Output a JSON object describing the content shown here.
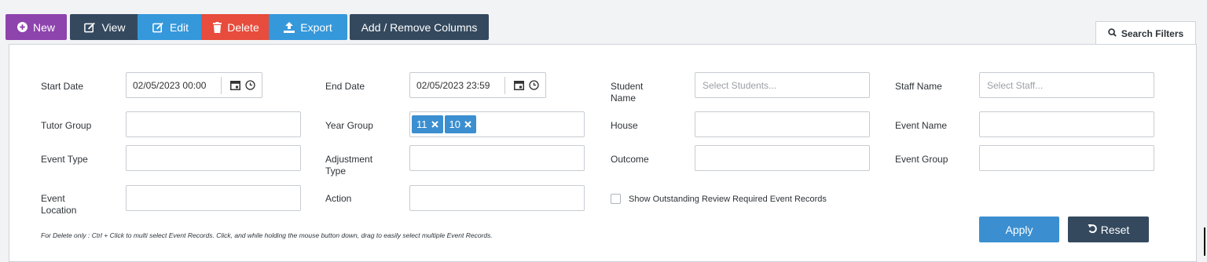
{
  "toolbar": {
    "new_label": "New",
    "view_label": "View",
    "edit_label": "Edit",
    "delete_label": "Delete",
    "export_label": "Export",
    "columns_label": "Add / Remove Columns"
  },
  "search_tab": {
    "label": "Search Filters"
  },
  "filters": {
    "start_date": {
      "label": "Start Date",
      "value": "02/05/2023 00:00"
    },
    "end_date": {
      "label": "End Date",
      "value": "02/05/2023 23:59"
    },
    "student_name": {
      "label_line1": "Student",
      "label_line2": "Name",
      "placeholder": "Select Students..."
    },
    "staff_name": {
      "label": "Staff Name",
      "placeholder": "Select Staff..."
    },
    "tutor_group": {
      "label": "Tutor Group"
    },
    "year_group": {
      "label": "Year Group",
      "tags": [
        "11",
        "10"
      ]
    },
    "house": {
      "label": "House"
    },
    "event_name": {
      "label": "Event Name"
    },
    "event_type": {
      "label": "Event Type"
    },
    "adjustment_type": {
      "label_line1": "Adjustment",
      "label_line2": "Type"
    },
    "outcome": {
      "label": "Outcome"
    },
    "event_group": {
      "label": "Event Group"
    },
    "event_location": {
      "label_line1": "Event",
      "label_line2": "Location"
    },
    "action": {
      "label": "Action"
    },
    "outstanding_review": {
      "label": "Show Outstanding Review Required Event Records",
      "checked": false
    }
  },
  "note": "For Delete only : Ctrl + Click to multi select Event Records. Click, and while holding the mouse button down, drag to easily select multiple Event Records.",
  "buttons": {
    "apply_label": "Apply",
    "reset_label": "Reset"
  },
  "colors": {
    "purple": "#8e44ad",
    "dark": "#34495e",
    "blue": "#3498db",
    "red": "#e74c3c",
    "tag_blue": "#3b8fd0"
  }
}
